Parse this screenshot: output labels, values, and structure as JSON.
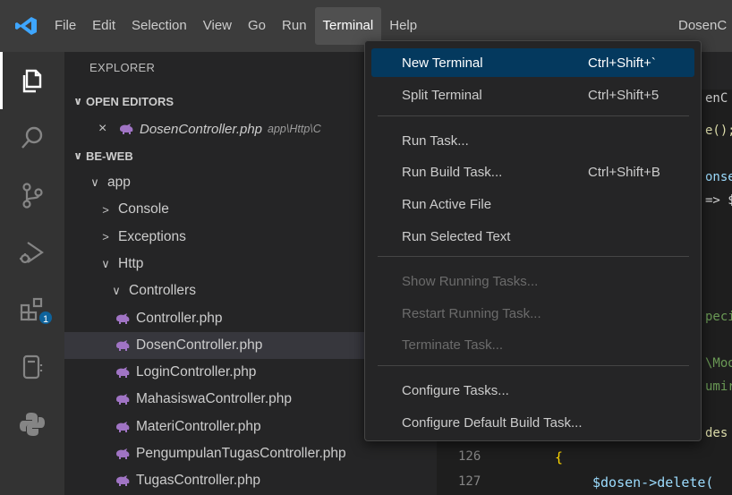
{
  "menubar": {
    "items": [
      "File",
      "Edit",
      "Selection",
      "View",
      "Go",
      "Run",
      "Terminal",
      "Help"
    ],
    "active": "Terminal",
    "window_title": "DosenC"
  },
  "colors": {
    "titlebar": "#3c3c3c",
    "activitybar": "#333333",
    "sidebar": "#252526",
    "editor": "#1e1e1e",
    "menu_highlight": "#04395e",
    "badge": "#0e639c",
    "php_icon": "#a074c4"
  },
  "activitybar": {
    "icons": [
      "explorer-icon",
      "search-icon",
      "source-control-icon",
      "run-debug-icon",
      "extensions-icon",
      "remote-explorer-icon",
      "python-icon"
    ],
    "extensions_badge": "1"
  },
  "explorer": {
    "title": "EXPLORER",
    "open_editors_label": "OPEN EDITORS",
    "open_editor_file": "DosenController.php",
    "open_editor_path": "app\\Http\\C",
    "project_label": "BE-WEB",
    "tree": [
      {
        "label": "app",
        "chevron": "∨"
      },
      {
        "label": "Console",
        "chevron": ">"
      },
      {
        "label": "Exceptions",
        "chevron": ">"
      },
      {
        "label": "Http",
        "chevron": "∨"
      },
      {
        "label": "Controllers",
        "chevron": "∨"
      },
      {
        "label": "Controller.php"
      },
      {
        "label": "DosenController.php"
      },
      {
        "label": "LoginController.php"
      },
      {
        "label": "MahasiswaController.php"
      },
      {
        "label": "MateriController.php"
      },
      {
        "label": "PengumpulanTugasController.php"
      },
      {
        "label": "TugasController.php"
      }
    ]
  },
  "editor": {
    "visible_fragments": [
      "enC",
      "e();",
      "onse",
      "=> $",
      "peci",
      "\\Moo",
      "umir",
      "des"
    ],
    "lines": [
      {
        "number": "126",
        "code": "{"
      },
      {
        "number": "127",
        "code": "$dosen->delete("
      }
    ]
  },
  "terminal_menu": {
    "items": [
      {
        "label": "New Terminal",
        "shortcut": "Ctrl+Shift+`"
      },
      {
        "label": "Split Terminal",
        "shortcut": "Ctrl+Shift+5"
      },
      {
        "label": "Run Task..."
      },
      {
        "label": "Run Build Task...",
        "shortcut": "Ctrl+Shift+B"
      },
      {
        "label": "Run Active File"
      },
      {
        "label": "Run Selected Text"
      },
      {
        "label": "Show Running Tasks..."
      },
      {
        "label": "Restart Running Task..."
      },
      {
        "label": "Terminate Task..."
      },
      {
        "label": "Configure Tasks..."
      },
      {
        "label": "Configure Default Build Task..."
      }
    ]
  }
}
